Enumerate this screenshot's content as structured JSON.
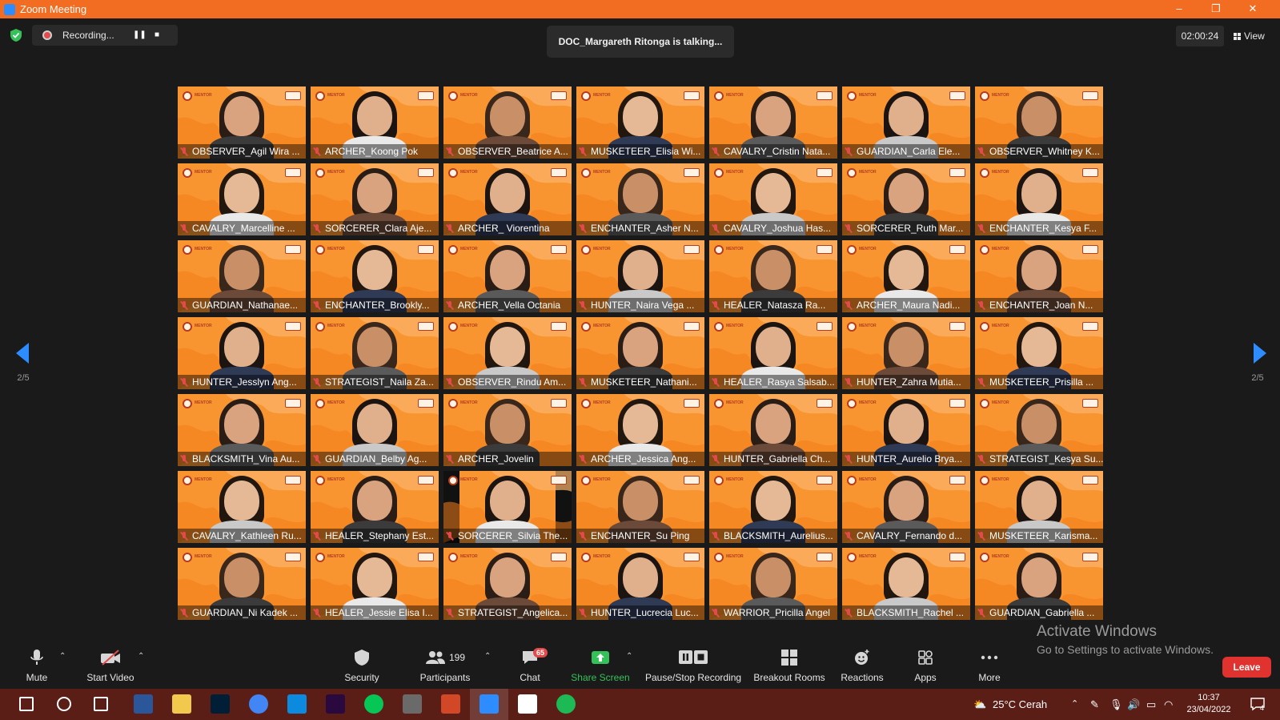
{
  "window": {
    "title": "Zoom Meeting",
    "minimize": "–",
    "restore": "❐",
    "close": "✕"
  },
  "top_bar": {
    "recording_label": "Recording...",
    "talking": "DOC_Margareth Ritonga is talking...",
    "timer": "02:00:24",
    "view_label": "View"
  },
  "pagination": {
    "left": "2/5",
    "right": "2/5"
  },
  "tile_logo_text": "MENTOR",
  "participants": [
    "OBSERVER_Agil Wira ...",
    "ARCHER_Koong Pok",
    "OBSERVER_Beatrice A...",
    "MUSKETEER_Elisia Wi...",
    "CAVALRY_Cristin Nata...",
    "GUARDIAN_Carla Ele...",
    "OBSERVER_Whitney K...",
    "CAVALRY_Marcelline ...",
    "SORCERER_Clara Aje...",
    "ARCHER_ Viorentina",
    "ENCHANTER_Asher N...",
    "CAVALRY_Joshua Has...",
    "SORCERER_Ruth Mar...",
    "ENCHANTER_Kesya F...",
    "GUARDIAN_Nathanae...",
    "ENCHANTER_Brookly...",
    "ARCHER_Vella Octania",
    "HUNTER_Naira Vega ...",
    "HEALER_Natasza Ra...",
    "ARCHER_Maura Nadi...",
    "ENCHANTER_Joan N...",
    "HUNTER_Jesslyn Ang...",
    "STRATEGIST_Naila Za...",
    "OBSERVER_Rindu Am...",
    "MUSKETEER_Nathani...",
    "HEALER_Rasya Salsab...",
    "HUNTER_Zahra Mutia...",
    "MUSKETEER_Prisilla ...",
    "BLACKSMITH_Vina Au...",
    "GUARDIAN_Belby Ag...",
    "ARCHER_Jovelin",
    "ARCHER_Jessica Ang...",
    "HUNTER_Gabriella Ch...",
    "HUNTER_Aurelio Brya...",
    "STRATEGIST_Kesya Su...",
    "CAVALRY_Kathleen Ru...",
    "HEALER_Stephany Est...",
    "SORCERER_Silvia The...",
    "ENCHANTER_Su Ping",
    "BLACKSMITH_Aurelius...",
    "CAVALRY_Fernando d...",
    "MUSKETEER_Karisma...",
    "GUARDIAN_Ni Kadek ...",
    "HEALER_Jessie Elisa I...",
    "STRATEGIST_Angelica...",
    "HUNTER_Lucrecia Luc...",
    "WARRIOR_Pricilla Angel",
    "BLACKSMITH_Rachel ...",
    "GUARDIAN_Gabriella ..."
  ],
  "watermark": {
    "title": "Activate Windows",
    "subtitle": "Go to Settings to activate Windows."
  },
  "toolbar": {
    "mute": "Mute",
    "start_video": "Start Video",
    "security": "Security",
    "participants": "Participants",
    "participants_count": "199",
    "chat": "Chat",
    "chat_badge": "65",
    "share_screen": "Share Screen",
    "pause_stop_recording": "Pause/Stop Recording",
    "breakout_rooms": "Breakout Rooms",
    "reactions": "Reactions",
    "apps": "Apps",
    "more": "More",
    "leave": "Leave"
  },
  "taskbar": {
    "weather": "25°C  Cerah",
    "time": "10:37",
    "date": "23/04/2022",
    "notifications": "4",
    "apps": [
      "start-icon",
      "search-icon",
      "task-view-icon",
      "word-icon",
      "file-explorer-icon",
      "photoshop-icon",
      "chrome-icon",
      "edge-icon",
      "premiere-icon",
      "line-icon",
      "clock-app-icon",
      "powerpoint-icon",
      "zoom-icon",
      "notion-icon",
      "spotify-icon"
    ]
  },
  "colors": {
    "titlebar": "#f26d21",
    "tile_orange": "#f89530",
    "accent_blue": "#2d8cff",
    "share_green": "#35c15a",
    "leave_red": "#e0322e",
    "taskbar": "#5a1e16"
  }
}
